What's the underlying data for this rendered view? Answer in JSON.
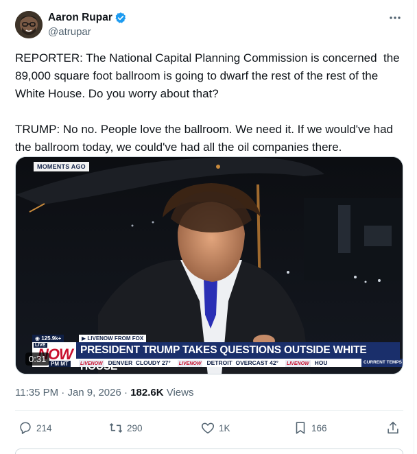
{
  "author": {
    "name": "Aaron Rupar",
    "handle": "@atrupar",
    "verified": true,
    "verified_color": "#1d9bf0"
  },
  "more_icon": "more-horizontal-icon",
  "tweet": {
    "text": "REPORTER: The National Capital Planning Commission is concerned  the 89,000 square foot ballroom is going to dwarf the rest of the rest of the White House. Do you worry about that?\n\nTRUMP: No no. People love the ballroom. We need it. If we would've had the ballroom today, we could've had all the oil companies there."
  },
  "video": {
    "moments_ago": "MOMENTS AGO",
    "views_badge": "125.9k+",
    "source_tag": "LIVENOW FROM FOX",
    "live_tag": "LIVE",
    "now_logo": "NOW",
    "time_zone": "PM MT",
    "headline": "PRESIDENT TRUMP TAKES QUESTIONS OUTSIDE WHITE HOUSE",
    "ticker": [
      {
        "logo": "LIVENOW",
        "city": "DENVER",
        "cond": "CLOUDY 27°"
      },
      {
        "logo": "LIVENOW",
        "city": "DETROIT",
        "cond": "OVERCAST 42°"
      },
      {
        "logo": "LIVENOW",
        "city": "HOU",
        "cond": ""
      }
    ],
    "temps_label": "CURRENT TEMPS",
    "time_badge": "0:31"
  },
  "meta": {
    "time": "11:35 PM",
    "separator": " · ",
    "date": "Jan 9, 2026",
    "views_count": "182.6K",
    "views_label": " Views"
  },
  "actions": {
    "reply_count": "214",
    "retweet_count": "290",
    "like_count": "1K",
    "bookmark_count": "166"
  },
  "colors": {
    "text": "#0f1419",
    "muted": "#536471",
    "border": "#cfd9de",
    "headline_bg": "#1a2f6b",
    "now_red": "#c8102e"
  }
}
